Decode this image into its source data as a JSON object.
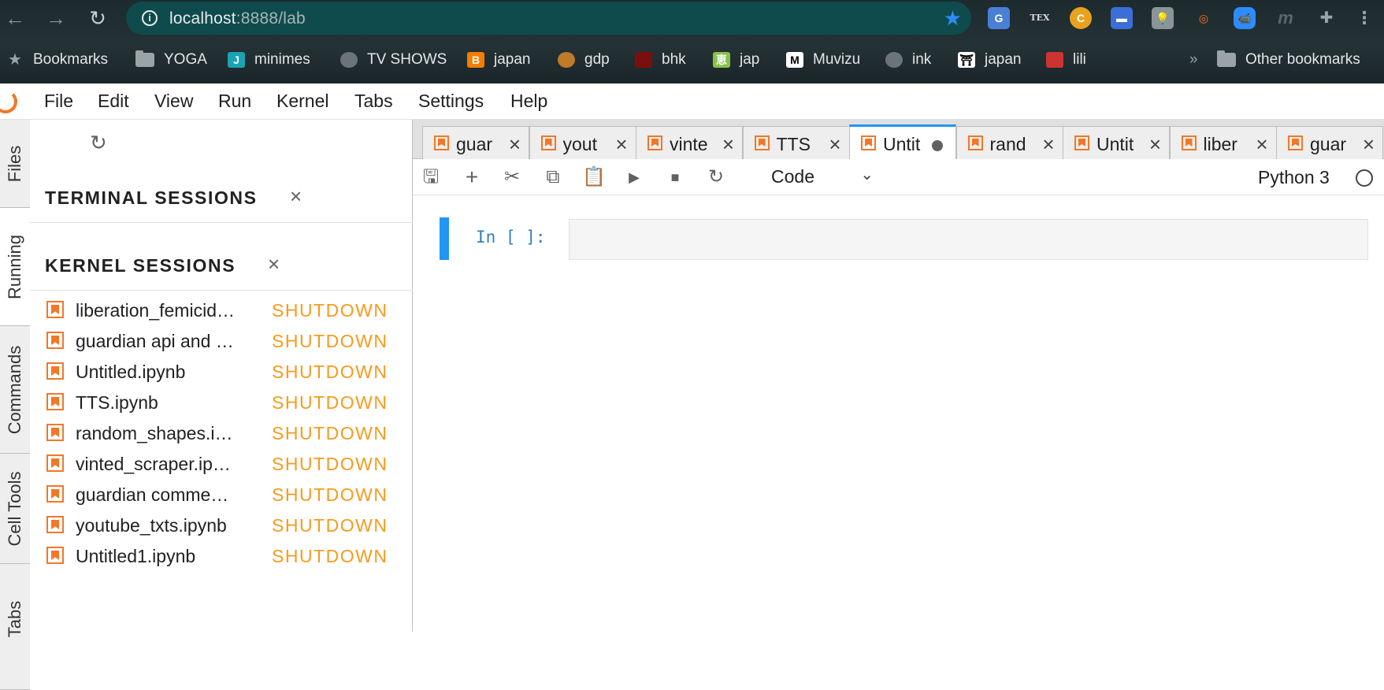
{
  "browser": {
    "url_host": "localhost",
    "url_path": ":8888/lab",
    "nav": {
      "back": "←",
      "forward": "→",
      "reload": "↻"
    },
    "extensions": [
      "G",
      "TEX",
      "C",
      "▬",
      "💡",
      "◎",
      "📹",
      "m",
      "✚",
      "⋮"
    ],
    "bookmarks": [
      {
        "label": "Bookmarks",
        "icon": "star-icon"
      },
      {
        "label": "YOGA",
        "icon": "folder-icon"
      },
      {
        "label": "minimes",
        "icon": "j-icon"
      },
      {
        "label": "TV SHOWS",
        "icon": "globe-icon"
      },
      {
        "label": "japan",
        "icon": "blogger-icon"
      },
      {
        "label": "gdp",
        "icon": "waffle-icon"
      },
      {
        "label": "bhk",
        "icon": "red-icon"
      },
      {
        "label": "jap",
        "icon": "kanji-icon"
      },
      {
        "label": "Muvizu",
        "icon": "m-icon"
      },
      {
        "label": "ink",
        "icon": "globe-icon"
      },
      {
        "label": "japan",
        "icon": "figure-icon"
      },
      {
        "label": "lili",
        "icon": "laptop-icon"
      }
    ],
    "overflow": "»",
    "other_bookmarks": "Other bookmarks"
  },
  "menubar": {
    "items": [
      "File",
      "Edit",
      "View",
      "Run",
      "Kernel",
      "Tabs",
      "Settings",
      "Help"
    ]
  },
  "sidebar": {
    "tabs": [
      "Files",
      "Running",
      "Commands",
      "Cell Tools",
      "Tabs"
    ],
    "active": "Running"
  },
  "running": {
    "terminal_title": "TERMINAL SESSIONS",
    "kernel_title": "KERNEL SESSIONS",
    "close_glyph": "×",
    "shutdown_label": "SHUTDOWN",
    "kernels": [
      "liberation_femicid…",
      "guardian api and …",
      "Untitled.ipynb",
      "TTS.ipynb",
      "random_shapes.i…",
      "vinted_scraper.ip…",
      "guardian comme…",
      "youtube_txts.ipynb",
      "Untitled1.ipynb"
    ]
  },
  "doc_tabs": [
    {
      "label": "guar",
      "active": false
    },
    {
      "label": "yout",
      "active": false
    },
    {
      "label": "vinte",
      "active": false
    },
    {
      "label": "TTS",
      "active": false
    },
    {
      "label": "Untit",
      "active": true
    },
    {
      "label": "rand",
      "active": false
    },
    {
      "label": "Untit",
      "active": false
    },
    {
      "label": "liber",
      "active": false
    },
    {
      "label": "guar",
      "active": false
    }
  ],
  "notebook": {
    "cell_type": "Code",
    "kernel_name": "Python 3",
    "prompt": "In [ ]:",
    "cell_source": ""
  },
  "colors": {
    "accent": "#2196f3",
    "jupyter_orange": "#f37726",
    "shutdown": "#f89a1c"
  }
}
